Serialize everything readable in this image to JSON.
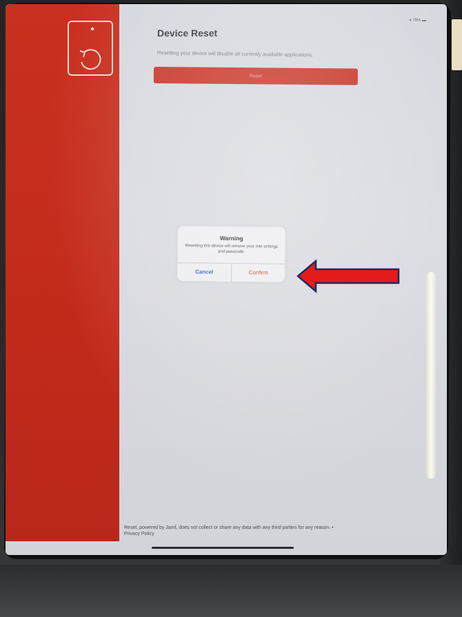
{
  "status_bar": {
    "battery": "79%"
  },
  "header": {
    "title": "Device Reset",
    "subtitle": "Resetting your device will disable all currently available applications."
  },
  "reset_button": {
    "label": "Reset"
  },
  "dialog": {
    "title": "Warning",
    "message": "Resetting this device will remove your role settings and passcode.",
    "cancel_label": "Cancel",
    "confirm_label": "Confirm"
  },
  "footer": {
    "text": "Reset, powered by Jamf, does not collect or share any data with any third parties for any reason. •",
    "privacy_link": "Privacy Policy"
  },
  "colors": {
    "sidebar": "#c9301f",
    "accent_red": "#c9372a",
    "link_blue": "#2d5fc4",
    "annotation_arrow": "#e31b1b"
  },
  "icons": {
    "sidebar_icon": "device-reset-icon",
    "annotation": "left-arrow-annotation"
  }
}
